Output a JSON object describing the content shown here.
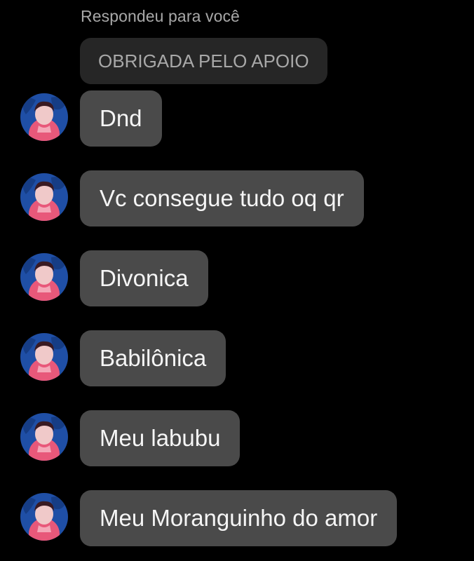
{
  "reply": {
    "caption": "Respondeu para você",
    "quoted_text": "OBRIGADA PELO APOIO"
  },
  "messages": [
    {
      "text": "Dnd",
      "avatar_icon": "profile-photo-avatar"
    },
    {
      "text": "Vc consegue tudo oq qr",
      "avatar_icon": "profile-photo-avatar"
    },
    {
      "text": "Divonica",
      "avatar_icon": "profile-photo-avatar"
    },
    {
      "text": "Babilônica",
      "avatar_icon": "profile-photo-avatar"
    },
    {
      "text": "Meu labubu",
      "avatar_icon": "profile-photo-avatar"
    },
    {
      "text": "Meu Moranguinho do amor",
      "avatar_icon": "profile-photo-avatar"
    }
  ],
  "colors": {
    "background": "#000000",
    "message_bubble": "#4a4a4a",
    "quoted_bubble": "#262626",
    "caption_text": "#a8a8a8",
    "message_text": "#f5f5f5",
    "avatar_blue": "#1f4fa6",
    "avatar_pink": "#e8587a"
  }
}
